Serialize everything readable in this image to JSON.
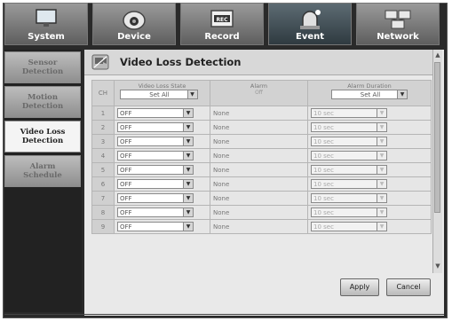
{
  "tabs": [
    {
      "label": "System",
      "icon": "monitor-icon",
      "active": false
    },
    {
      "label": "Device",
      "icon": "camera-icon",
      "active": false
    },
    {
      "label": "Record",
      "icon": "record-icon",
      "active": false
    },
    {
      "label": "Event",
      "icon": "alarm-icon",
      "active": true
    },
    {
      "label": "Network",
      "icon": "network-icon",
      "active": false
    }
  ],
  "sidebar": {
    "items": [
      {
        "label": "Sensor\nDetection",
        "active": false
      },
      {
        "label": "Motion\nDetection",
        "active": false
      },
      {
        "label": "Video Loss\nDetection",
        "active": true
      },
      {
        "label": "Alarm\nSchedule",
        "active": false
      }
    ]
  },
  "page": {
    "title": "Video Loss Detection",
    "icon": "video-loss-icon"
  },
  "table": {
    "headers": {
      "ch": "CH",
      "video_loss_state": "Video Loss State",
      "alarm": "Alarm",
      "alarm_sub": "Off",
      "alarm_duration": "Alarm Duration"
    },
    "header_selects": {
      "video_loss_state": "Set All",
      "alarm_duration": "Set All"
    },
    "rows": [
      {
        "ch": "1",
        "state": "OFF",
        "alarm": "None",
        "duration": "10 sec"
      },
      {
        "ch": "2",
        "state": "OFF",
        "alarm": "None",
        "duration": "10 sec"
      },
      {
        "ch": "3",
        "state": "OFF",
        "alarm": "None",
        "duration": "10 sec"
      },
      {
        "ch": "4",
        "state": "OFF",
        "alarm": "None",
        "duration": "10 sec"
      },
      {
        "ch": "5",
        "state": "OFF",
        "alarm": "None",
        "duration": "10 sec"
      },
      {
        "ch": "6",
        "state": "OFF",
        "alarm": "None",
        "duration": "10 sec"
      },
      {
        "ch": "7",
        "state": "OFF",
        "alarm": "None",
        "duration": "10 sec"
      },
      {
        "ch": "8",
        "state": "OFF",
        "alarm": "None",
        "duration": "10 sec"
      },
      {
        "ch": "9",
        "state": "OFF",
        "alarm": "None",
        "duration": "10 sec"
      }
    ]
  },
  "buttons": {
    "apply": "Apply",
    "cancel": "Cancel"
  }
}
